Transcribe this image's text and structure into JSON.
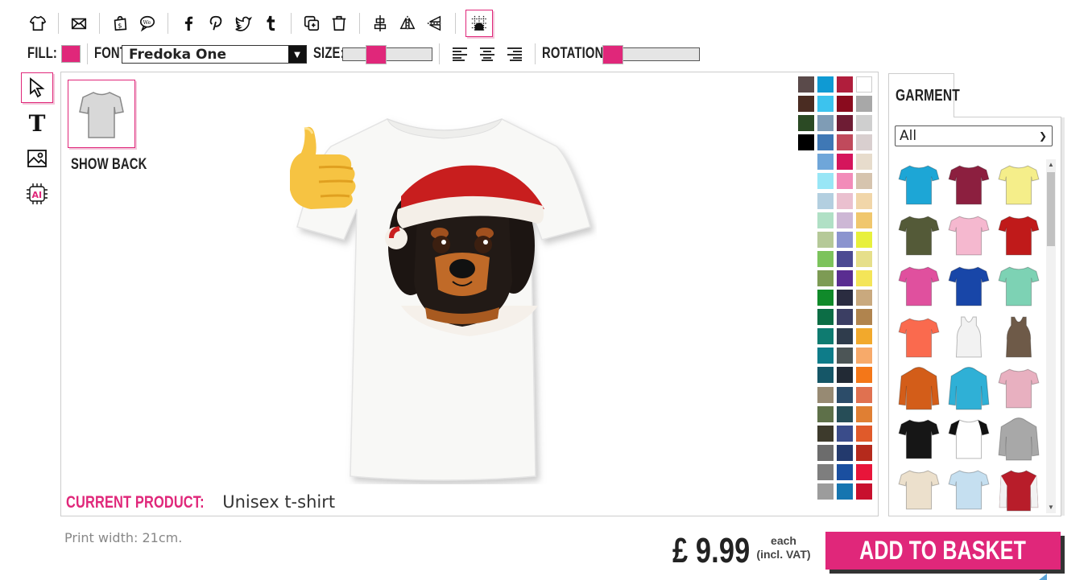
{
  "toolbar": {
    "icons": [
      "tshirt-icon",
      "envelope-icon",
      "shopping-bag-icon",
      "speech-bubble-icon",
      "facebook-icon",
      "pinterest-icon",
      "twitter-icon",
      "tumblr-icon",
      "duplicate-icon",
      "trash-icon",
      "align-vertical-icon",
      "flip-horizontal-icon",
      "flip-vertical-icon",
      "grid-snap-icon"
    ]
  },
  "props": {
    "fill_label": "FILL:",
    "fill_color": "#e0277a",
    "font_label": "FONT:",
    "font_value": "Fredoka One",
    "size_label": "SIZE:",
    "rotation_label": "ROTATION:"
  },
  "canvas": {
    "show_back_label": "SHOW BACK",
    "current_product_label": "CURRENT PRODUCT:",
    "current_product_value": "Unisex t-shirt"
  },
  "palette": [
    "#5a4a4a",
    "#0f9ad3",
    "#b01e3c",
    "#ffffff",
    "#4a2c22",
    "#3cc3ee",
    "#8a0b1e",
    "#a8a8a8",
    "#2b4a24",
    "#7f9cb5",
    "#6e1c34",
    "#cfcfcf",
    "#000000",
    "#3f78b5",
    "#c04a5c",
    "#d9cfcf",
    "#ffffff",
    "#6fa6d9",
    "#d5155c",
    "#e7dccc",
    "#ffffff",
    "#98e6f6",
    "#f28bb9",
    "#d6c4ae",
    "#ffffff",
    "#b3cfe0",
    "#eac0cf",
    "#f1d6a9",
    "#ffffff",
    "#b0e0c5",
    "#cdb7d5",
    "#f0c76d",
    "#ffffff",
    "#b5c998",
    "#8b94cf",
    "#e8f03c",
    "#ffffff",
    "#7cc35c",
    "#4c4a92",
    "#e6df8a",
    "#ffffff",
    "#7d9b54",
    "#5a2d91",
    "#f4e558",
    "#ffffff",
    "#108a2a",
    "#2a2c40",
    "#c9a97e",
    "#ffffff",
    "#0c6d45",
    "#3b3e63",
    "#b0844e",
    "#ffffff",
    "#0e7b70",
    "#2f3c4c",
    "#f2a92c",
    "#ffffff",
    "#0e7c89",
    "#4c5556",
    "#f7aa6a",
    "#ffffff",
    "#155667",
    "#222a35",
    "#f47718",
    "#ffffff",
    "#978a73",
    "#2c4c69",
    "#e07150",
    "#ffffff",
    "#5e7049",
    "#264d57",
    "#e07f33",
    "#ffffff",
    "#3d3a2c",
    "#3a4c8a",
    "#e05a2a",
    "#ffffff",
    "#6c6c6c",
    "#233a6d",
    "#b52a1c",
    "#ffffff",
    "#7e7e7e",
    "#1a4fa0",
    "#e8153a",
    "#ffffff",
    "#9c9c9c",
    "#1675b0",
    "#c8102e"
  ],
  "garment": {
    "tab_label": "GARMENT",
    "filter_value": "All",
    "items": [
      {
        "name": "turquoise-tshirt",
        "color": "#1da6d6",
        "type": "tee"
      },
      {
        "name": "burgundy-tshirt",
        "color": "#8c1f3f",
        "type": "tee"
      },
      {
        "name": "lemon-tshirt",
        "color": "#f5ee8a",
        "type": "tee"
      },
      {
        "name": "olive-tshirt",
        "color": "#545a38",
        "type": "tee"
      },
      {
        "name": "pink-tshirt",
        "color": "#f5b8cf",
        "type": "tee"
      },
      {
        "name": "red-tshirt",
        "color": "#c01a1a",
        "type": "tee"
      },
      {
        "name": "fuchsia-tshirt",
        "color": "#e0509e",
        "type": "tee"
      },
      {
        "name": "royal-blue-tshirt",
        "color": "#1846a8",
        "type": "tee"
      },
      {
        "name": "mint-tshirt",
        "color": "#7dd2b4",
        "type": "tee"
      },
      {
        "name": "coral-tshirt",
        "color": "#fa6a4e",
        "type": "tee"
      },
      {
        "name": "white-vest",
        "color": "#f2f2f2",
        "type": "vest"
      },
      {
        "name": "brown-vest",
        "color": "#6e5a48",
        "type": "vest"
      },
      {
        "name": "orange-hoodie",
        "color": "#d35d19",
        "type": "hoodie"
      },
      {
        "name": "blue-hoodie",
        "color": "#2fb0d6",
        "type": "hoodie"
      },
      {
        "name": "tie-dye-tshirt",
        "color": "#e8b0c0",
        "type": "tee"
      },
      {
        "name": "black-tshirt",
        "color": "#161616",
        "type": "tee"
      },
      {
        "name": "raglan-tshirt",
        "color": "#ffffff",
        "type": "tee"
      },
      {
        "name": "grey-hoodie",
        "color": "#a8a8a8",
        "type": "hoodie"
      },
      {
        "name": "sand-tshirt",
        "color": "#ece0cc",
        "type": "tee"
      },
      {
        "name": "light-blue-tshirt",
        "color": "#c5dff0",
        "type": "tee"
      },
      {
        "name": "red-varsity-jacket",
        "color": "#b81d2a",
        "type": "jacket"
      }
    ]
  },
  "footer": {
    "print_width": "Print width: 21cm.",
    "price": "£ 9.99",
    "each_line1": "each",
    "each_line2": "(incl. VAT)",
    "add_to_basket": "ADD TO BASKET"
  }
}
